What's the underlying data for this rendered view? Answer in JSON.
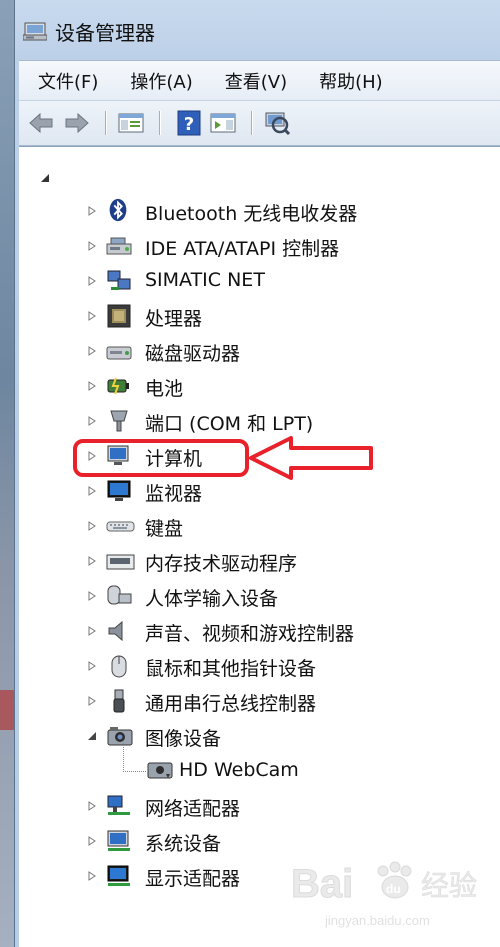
{
  "window": {
    "title": "设备管理器"
  },
  "menu": [
    "文件(F)",
    "操作(A)",
    "查看(V)",
    "帮助(H)"
  ],
  "toolbar": [
    "back-icon",
    "forward-icon",
    "show-hide-console-tree-icon",
    "help-icon",
    "show-hide-action-pane-icon",
    "scan-hardware-icon"
  ],
  "tree": {
    "nodes": [
      {
        "label": "Bluetooth 无线电收发器",
        "icon": "bluetooth-icon",
        "expanded": false
      },
      {
        "label": "IDE ATA/ATAPI 控制器",
        "icon": "ide-controller-icon",
        "expanded": false
      },
      {
        "label": "SIMATIC NET",
        "icon": "network-device-icon",
        "expanded": false
      },
      {
        "label": "处理器",
        "icon": "processor-icon",
        "expanded": false
      },
      {
        "label": "磁盘驱动器",
        "icon": "disk-drive-icon",
        "expanded": false
      },
      {
        "label": "电池",
        "icon": "battery-icon",
        "expanded": false
      },
      {
        "label": "端口 (COM 和 LPT)",
        "icon": "port-icon",
        "expanded": false
      },
      {
        "label": "计算机",
        "icon": "computer-icon",
        "expanded": false
      },
      {
        "label": "监视器",
        "icon": "monitor-icon",
        "expanded": false
      },
      {
        "label": "键盘",
        "icon": "keyboard-icon",
        "expanded": false
      },
      {
        "label": "内存技术驱动程序",
        "icon": "memory-icon",
        "expanded": false
      },
      {
        "label": "人体学输入设备",
        "icon": "hid-icon",
        "expanded": false
      },
      {
        "label": "声音、视频和游戏控制器",
        "icon": "sound-icon",
        "expanded": false
      },
      {
        "label": "鼠标和其他指针设备",
        "icon": "mouse-icon",
        "expanded": false
      },
      {
        "label": "通用串行总线控制器",
        "icon": "usb-icon",
        "expanded": false
      },
      {
        "label": "图像设备",
        "icon": "imaging-device-icon",
        "expanded": true
      },
      {
        "label": "HD WebCam",
        "icon": "webcam-icon",
        "child": true
      },
      {
        "label": "网络适配器",
        "icon": "network-adapter-icon",
        "expanded": false
      },
      {
        "label": "系统设备",
        "icon": "system-device-icon",
        "expanded": false
      },
      {
        "label": "显示适配器",
        "icon": "display-adapter-icon",
        "expanded": false
      }
    ]
  },
  "watermark": {
    "brand": "Bai",
    "paw": "du",
    "cn": "经验",
    "url": "jingyan.baidu.com"
  },
  "colors": {
    "highlight": "#e8212b",
    "arrow": "#e8212b"
  }
}
